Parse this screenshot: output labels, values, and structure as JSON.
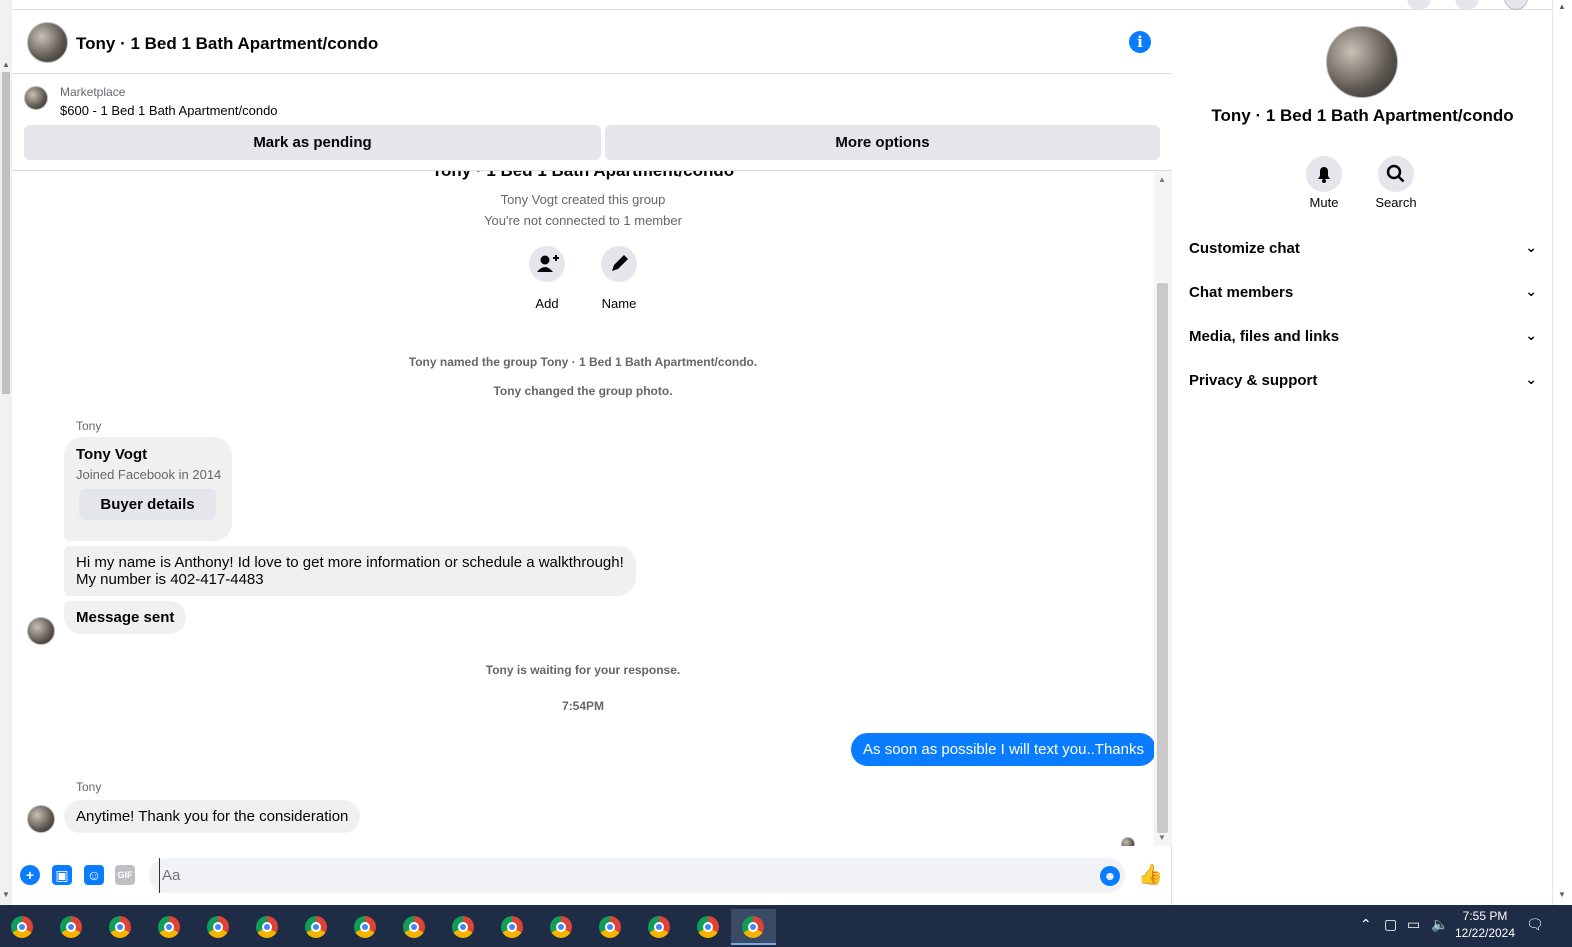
{
  "header": {
    "title": "Tony · 1 Bed 1 Bath Apartment/condo"
  },
  "marketplace": {
    "label": "Marketplace",
    "listing": "$600 - 1 Bed 1 Bath Apartment/condo",
    "mark_pending": "Mark as pending",
    "more_options": "More options"
  },
  "conversation": {
    "group_title": "Tony · 1 Bed 1 Bath Apartment/condo",
    "created": "Tony Vogt created this group",
    "not_connected": "You're not connected to 1 member",
    "add_label": "Add",
    "name_label": "Name",
    "event_named": "Tony named the group Tony · 1 Bed 1 Bath Apartment/condo.",
    "event_photo": "Tony changed the group photo.",
    "sender1": "Tony",
    "card_name": "Tony Vogt",
    "card_sub": "Joined Facebook in 2014",
    "card_button": "Buyer details",
    "msg1_line1": "Hi my name is Anthony! Id love to get more information or schedule a walkthrough!",
    "msg1_line2": "My number is 402-417-4483",
    "msg2": "Message sent",
    "waiting": "Tony is waiting for your response.",
    "time": "7:54PM",
    "reply": "As soon as possible I will text you..Thanks",
    "sender2": "Tony",
    "msg3": "Anytime! Thank you for the consideration"
  },
  "composer": {
    "placeholder": "Aa"
  },
  "side": {
    "title": "Tony · 1 Bed 1 Bath Apartment/condo",
    "mute": "Mute",
    "search": "Search",
    "sections": [
      "Customize chat",
      "Chat members",
      "Media, files and links",
      "Privacy & support"
    ]
  },
  "taskbar": {
    "time": "7:55 PM",
    "date": "12/22/2024"
  },
  "colors": {
    "accent": "#0a7cff",
    "bubble_in": "#f0f0f0",
    "taskbar": "#1f2c45"
  }
}
